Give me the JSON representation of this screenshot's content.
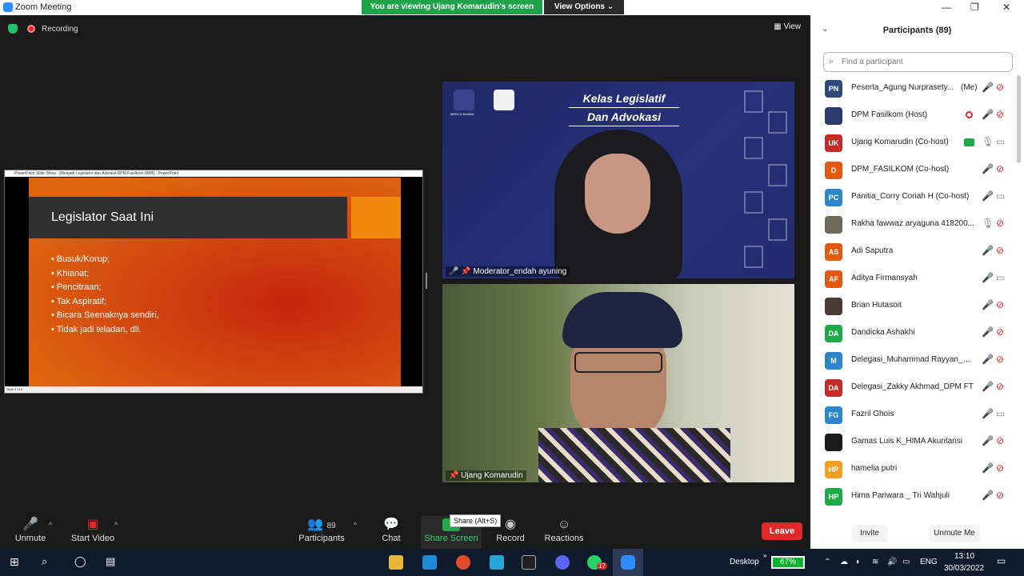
{
  "window": {
    "title": "Zoom Meeting",
    "minimize": "—",
    "maximize": "❐",
    "close": "✕"
  },
  "banner": {
    "text": "You are viewing Ujang Komarudin's screen",
    "view_options": "View Options ⌄"
  },
  "status": {
    "recording": "Recording",
    "view": "View"
  },
  "slide": {
    "window_title": "PowerPoint Slide Show - [Menjadi Legislator dan Advokat DPM Fasilkom UMB] - PowerPoint",
    "title": "Legislator Saat Ini",
    "bullets": [
      "Busuk/Korup;",
      "Khianat;",
      "Pencitraan;",
      "Tak Aspiratif;",
      "Bicara Seenaknya sendiri,",
      "Tidak jadi teladan, dll."
    ],
    "status_bar": "Slide 3 of 9"
  },
  "video_moderator": {
    "banner_line1": "Kelas Legislatif",
    "banner_line2": "Dan Advokasi",
    "name": "Moderator_endah ayuning",
    "logo_text": "MERCU BUANA"
  },
  "video_speaker": {
    "name": "Ujang Komarudin"
  },
  "toolbar": {
    "unmute": "Unmute",
    "start_video": "Start Video",
    "participants": "Participants",
    "participants_count": "89",
    "chat": "Chat",
    "share_screen": "Share Screen",
    "record": "Record",
    "reactions": "Reactions",
    "tooltip": "Share (Alt+S)",
    "leave": "Leave"
  },
  "panel": {
    "title": "Participants (89)",
    "search_placeholder": "Find a participant",
    "invite": "Invite",
    "unmute_me": "Unmute Me",
    "participants": [
      {
        "initials": "PN",
        "color": "#2d4a78",
        "name": "Peserta_Agung Nurprasety...",
        "suffix": "(Me)",
        "mic": "muted",
        "cam": "off",
        "ind": ""
      },
      {
        "initials": "",
        "color": "#2a3a6a",
        "name": "DPM Fasilkom (Host)",
        "suffix": "",
        "mic": "muted",
        "cam": "off",
        "ind": "rec"
      },
      {
        "initials": "UK",
        "color": "#c62b2b",
        "name": "Ujang Komarudin (Co-host)",
        "suffix": "",
        "mic": "on",
        "cam": "on",
        "ind": "share"
      },
      {
        "initials": "D",
        "color": "#e25a12",
        "name": "DPM_FASILKOM (Co-host)",
        "suffix": "",
        "mic": "muted",
        "cam": "off",
        "ind": ""
      },
      {
        "initials": "PC",
        "color": "#2d86c9",
        "name": "Panitia_Corry Coriah H (Co-host)",
        "suffix": "",
        "mic": "muted",
        "cam": "on",
        "ind": ""
      },
      {
        "initials": "",
        "color": "#6f6a5a",
        "name": "Rakha fawwaz aryaguna 418200...",
        "suffix": "",
        "mic": "on",
        "cam": "off",
        "ind": ""
      },
      {
        "initials": "AS",
        "color": "#e25a12",
        "name": "Adi Saputra",
        "suffix": "",
        "mic": "muted",
        "cam": "off",
        "ind": ""
      },
      {
        "initials": "AF",
        "color": "#e25a12",
        "name": "Aditya Firmansyah",
        "suffix": "",
        "mic": "muted",
        "cam": "on",
        "ind": ""
      },
      {
        "initials": "",
        "color": "#4a3a34",
        "name": "Brian Hutasoit",
        "suffix": "",
        "mic": "muted",
        "cam": "off",
        "ind": ""
      },
      {
        "initials": "DA",
        "color": "#1faa4a",
        "name": "Dandicka Ashakhi",
        "suffix": "",
        "mic": "muted",
        "cam": "off",
        "ind": ""
      },
      {
        "initials": "M",
        "color": "#2d86c9",
        "name": "Delegasi_Muhammad Rayyan_BE...",
        "suffix": "",
        "mic": "muted",
        "cam": "off",
        "ind": ""
      },
      {
        "initials": "DA",
        "color": "#c62b2b",
        "name": "Delegasi_Zakky Akhmad_DPM FT",
        "suffix": "",
        "mic": "muted",
        "cam": "off",
        "ind": ""
      },
      {
        "initials": "FG",
        "color": "#2d86c9",
        "name": "Fazril Ghois",
        "suffix": "",
        "mic": "muted",
        "cam": "on",
        "ind": ""
      },
      {
        "initials": "",
        "color": "#1a1a1a",
        "name": "Gamas Luis K_HIMA Akuntansi",
        "suffix": "",
        "mic": "muted",
        "cam": "off",
        "ind": ""
      },
      {
        "initials": "HP",
        "color": "#f0a020",
        "name": "hamelia putri",
        "suffix": "",
        "mic": "muted",
        "cam": "off",
        "ind": ""
      },
      {
        "initials": "HP",
        "color": "#1faa4a",
        "name": "Hima Pariwara _ Tri Wahjuli",
        "suffix": "",
        "mic": "muted",
        "cam": "off",
        "ind": ""
      }
    ]
  },
  "taskbar": {
    "desktop": "Desktop",
    "battery": "67%",
    "lang": "ENG",
    "time": "13:10",
    "date": "30/03/2022",
    "whatsapp_badge": "17"
  }
}
